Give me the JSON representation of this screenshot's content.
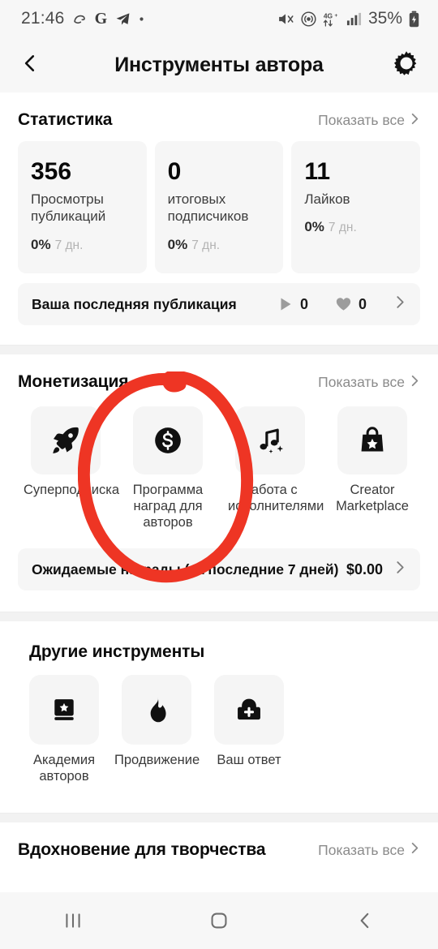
{
  "status_bar": {
    "time": "21:46",
    "battery_percent": "35%",
    "left_icons": [
      "opera-glyph-icon",
      "google-g-icon",
      "telegram-icon",
      "dot-icon"
    ],
    "right_icons": [
      "mute-icon",
      "hotspot-icon",
      "4g-plus-icon",
      "signal-bars-icon",
      "battery-charging-icon"
    ],
    "network_label": "4G+"
  },
  "appbar": {
    "title": "Инструменты автора",
    "back_icon": "chevron-left-icon",
    "settings_icon": "gear-icon"
  },
  "statistics": {
    "title": "Статистика",
    "show_all": "Показать все",
    "cards": [
      {
        "value": "356",
        "label": "Просмотры публикаций",
        "delta": "0%",
        "period": "7 дн."
      },
      {
        "value": "0",
        "label": "итоговых подписчиков",
        "delta": "0%",
        "period": "7 дн."
      },
      {
        "value": "11",
        "label": "Лайков",
        "delta": "0%",
        "period": "7 дн."
      }
    ],
    "last_post": {
      "label": "Ваша последняя публикация",
      "plays": "0",
      "likes": "0",
      "play_icon": "play-icon",
      "like_icon": "heart-icon",
      "chevron": "chevron-right-icon"
    }
  },
  "monetization": {
    "title": "Монетизация",
    "show_all": "Показать все",
    "tiles": [
      {
        "label": "Суперподписка",
        "icon": "rocket-icon"
      },
      {
        "label": "Программа наград для авторов",
        "icon": "dollar-coin-icon"
      },
      {
        "label": "Работа с исполнителями",
        "icon": "music-note-sparkle-icon"
      },
      {
        "label": "Creator Marketplace",
        "icon": "shopping-bag-star-icon"
      }
    ],
    "rewards_row": {
      "label": "Ожидаемые награды (за последние 7 дней)",
      "value": "$0.00",
      "chevron": "chevron-right-icon"
    }
  },
  "other_tools": {
    "title": "Другие инструменты",
    "tiles": [
      {
        "label": "Академия авторов",
        "icon": "book-star-icon"
      },
      {
        "label": "Продвижение",
        "icon": "flame-icon"
      },
      {
        "label": "Ваш ответ",
        "icon": "shield-plus-icon"
      }
    ]
  },
  "inspiration": {
    "title": "Вдохновение для творчества",
    "show_all": "Показать все"
  },
  "annotation": {
    "type": "hand-drawn-red-circle",
    "target": "Программа наград для авторов",
    "color": "#ee3524"
  },
  "nav_bar": {
    "recents_icon": "recents-icon",
    "home_icon": "home-icon",
    "back_icon": "back-icon"
  }
}
